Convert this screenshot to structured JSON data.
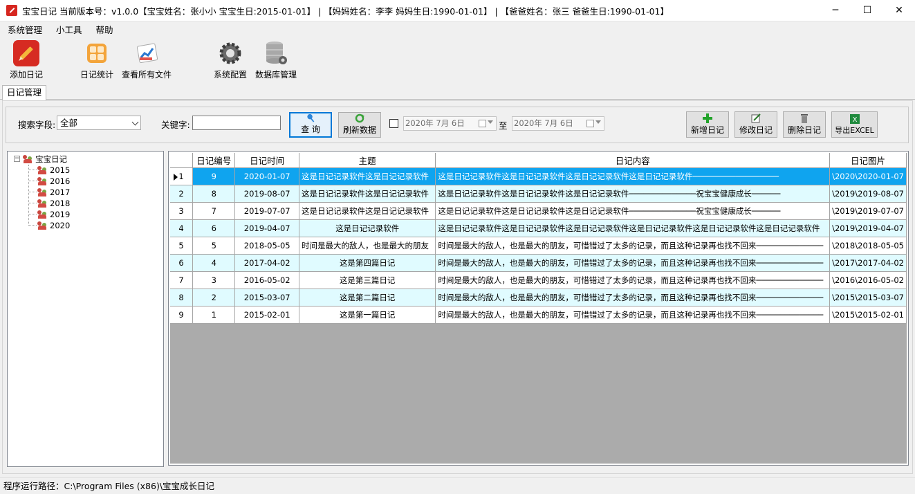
{
  "window": {
    "title": "宝宝日记  当前版本号：v1.0.0【宝宝姓名：张小小   宝宝生日:2015-01-01】 | 【妈妈姓名：李李   妈妈生日:1990-01-01】 | 【爸爸姓名：张三   爸爸生日:1990-01-01】",
    "minimize": "─",
    "maximize": "☐",
    "close": "✕"
  },
  "menu": [
    "系统管理",
    "小工具",
    "帮助"
  ],
  "toolbar": {
    "add_diary": "添加日记",
    "diary_stats": "日记统计",
    "view_files": "查看所有文件",
    "sys_config": "系统配置",
    "db_manage": "数据库管理"
  },
  "tab": "日记管理",
  "search": {
    "field_label": "搜索字段:",
    "field_value": "全部",
    "keyword_label": "关键字:",
    "keyword_value": "",
    "query_btn": "查 询",
    "refresh_btn": "刷新数据",
    "date_from": "2020年  7月  6日",
    "to_label": "至",
    "date_to": "2020年  7月  6日",
    "add_btn": "新增日记",
    "edit_btn": "修改日记",
    "delete_btn": "删除日记",
    "export_btn": "导出EXCEL"
  },
  "tree": {
    "root": "宝宝日记",
    "years": [
      "2015",
      "2016",
      "2017",
      "2018",
      "2019",
      "2020"
    ]
  },
  "grid": {
    "columns": [
      "日记编号",
      "日记时间",
      "主题",
      "日记内容",
      "日记图片"
    ],
    "rows": [
      {
        "n": "1",
        "id": "9",
        "date": "2020-01-07",
        "topic": "这是日记记录软件这是日记记录软件",
        "content": "这是日记记录软件这是日记记录软件这是日记记录软件这是日记记录软件──────────────────",
        "img": "\\2020\\2020-01-07"
      },
      {
        "n": "2",
        "id": "8",
        "date": "2019-08-07",
        "topic": "这是日记记录软件这是日记记录软件",
        "content": "这是日记记录软件这是日记记录软件这是日记记录软件──────────────祝宝宝健康成长──────",
        "img": "\\2019\\2019-08-07"
      },
      {
        "n": "3",
        "id": "7",
        "date": "2019-07-07",
        "topic": "这是日记记录软件这是日记记录软件",
        "content": "这是日记记录软件这是日记记录软件这是日记记录软件──────────────祝宝宝健康成长──────",
        "img": "\\2019\\2019-07-07"
      },
      {
        "n": "4",
        "id": "6",
        "date": "2019-04-07",
        "topic": "这是日记记录软件",
        "content": "这是日记记录软件这是日记记录软件这是日记记录软件这是日记记录软件这是日记记录软件这是日记记录软件",
        "img": "\\2019\\2019-04-07"
      },
      {
        "n": "5",
        "id": "5",
        "date": "2018-05-05",
        "topic": "时间是最大的敌人，也是最大的朋友",
        "content": "时间是最大的敌人，也是最大的朋友，可惜错过了太多的记录，而且这种记录再也找不回来──────────────",
        "img": "\\2018\\2018-05-05"
      },
      {
        "n": "6",
        "id": "4",
        "date": "2017-04-02",
        "topic": "这是第四篇日记",
        "content": "时间是最大的敌人，也是最大的朋友，可惜错过了太多的记录，而且这种记录再也找不回来──────────────",
        "img": "\\2017\\2017-04-02"
      },
      {
        "n": "7",
        "id": "3",
        "date": "2016-05-02",
        "topic": "这是第三篇日记",
        "content": "时间是最大的敌人，也是最大的朋友，可惜错过了太多的记录，而且这种记录再也找不回来──────────────",
        "img": "\\2016\\2016-05-02"
      },
      {
        "n": "8",
        "id": "2",
        "date": "2015-03-07",
        "topic": "这是第二篇日记",
        "content": "时间是最大的敌人，也是最大的朋友，可惜错过了太多的记录，而且这种记录再也找不回来──────────────",
        "img": "\\2015\\2015-03-07"
      },
      {
        "n": "9",
        "id": "1",
        "date": "2015-02-01",
        "topic": "这是第一篇日记",
        "content": "时间是最大的敌人，也是最大的朋友，可惜错过了太多的记录，而且这种记录再也找不回来──────────────",
        "img": "\\2015\\2015-02-01"
      }
    ]
  },
  "status": "程序运行路径：C:\\Program Files (x86)\\宝宝成长日记",
  "colors": {
    "selection": "#0fa4ef",
    "alt_row": "#e0fbff",
    "grid_bg": "#ababab",
    "accent": "#0078d7"
  }
}
